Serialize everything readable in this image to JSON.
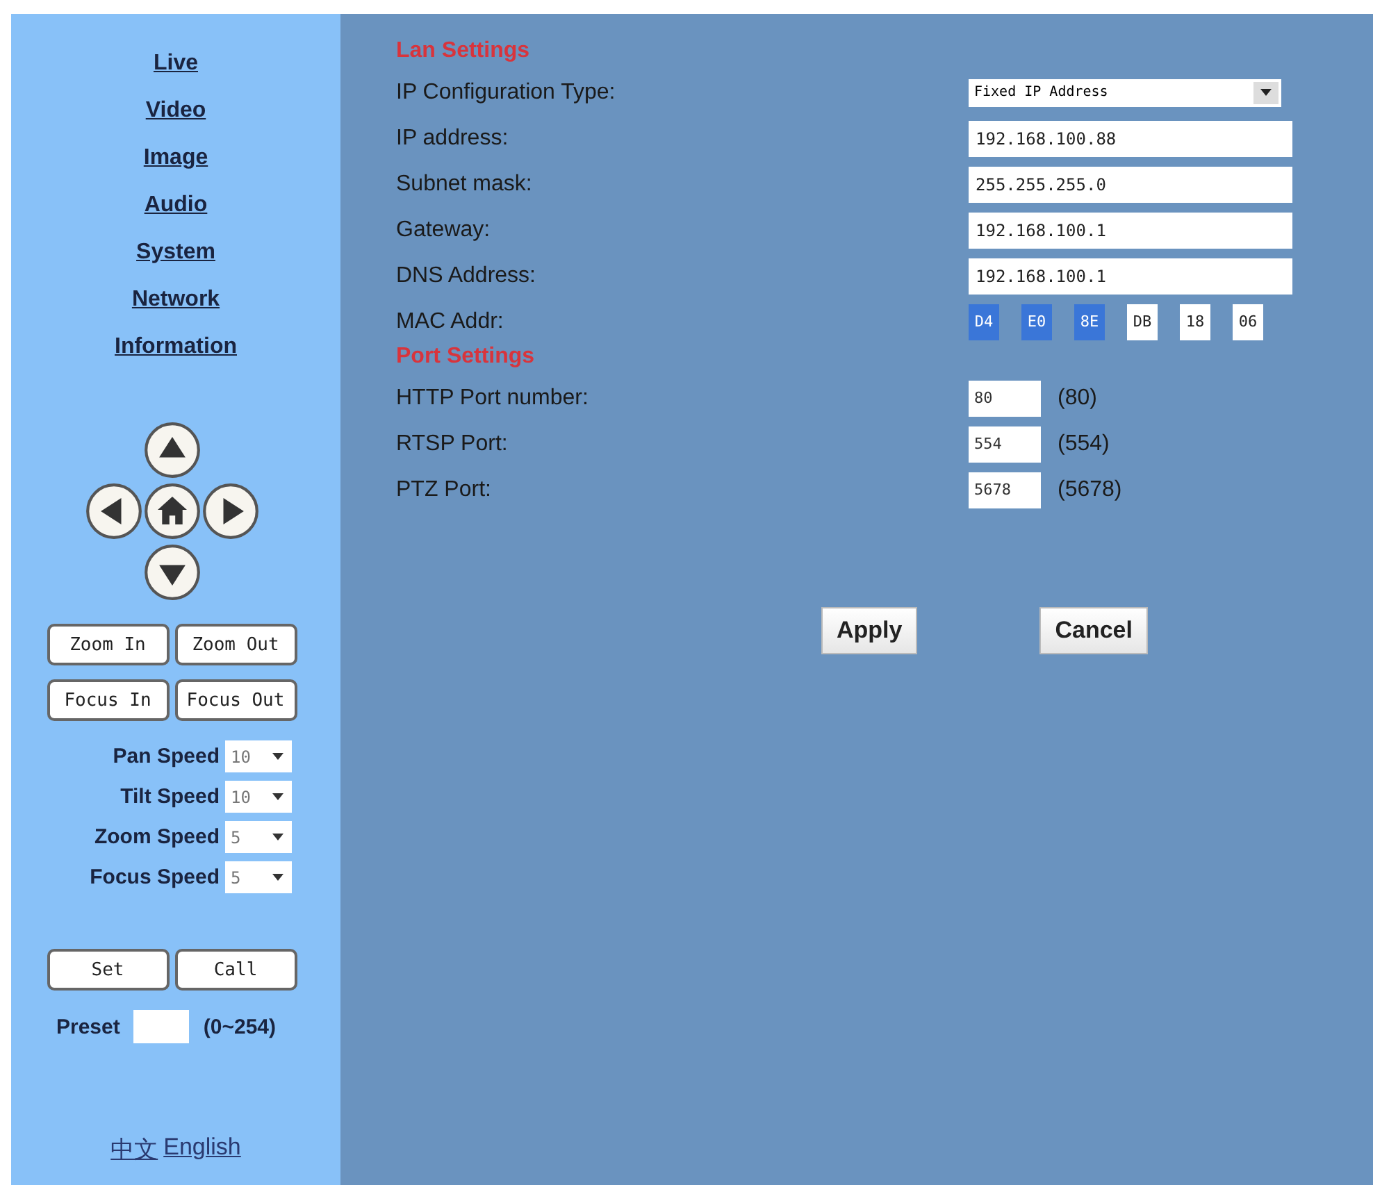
{
  "sidebar": {
    "nav": [
      {
        "label": "Live"
      },
      {
        "label": "Video"
      },
      {
        "label": "Image"
      },
      {
        "label": "Audio"
      },
      {
        "label": "System"
      },
      {
        "label": "Network"
      },
      {
        "label": "Information"
      }
    ],
    "lens_buttons": [
      "Zoom In",
      "Zoom Out",
      "Focus In",
      "Focus Out"
    ],
    "speeds": [
      {
        "label": "Pan Speed",
        "value": "10"
      },
      {
        "label": "Tilt Speed",
        "value": "10"
      },
      {
        "label": "Zoom Speed",
        "value": "5"
      },
      {
        "label": "Focus Speed",
        "value": "5"
      }
    ],
    "preset_buttons": [
      "Set",
      "Call"
    ],
    "preset": {
      "label": "Preset",
      "range": "(0~254)"
    },
    "languages": [
      "中文",
      "English"
    ]
  },
  "lan": {
    "title": "Lan Settings",
    "fields": [
      {
        "label": "IP Configuration Type:",
        "kind": "select",
        "value": "Fixed IP Address"
      },
      {
        "label": "IP address:",
        "kind": "text",
        "value": "192.168.100.88"
      },
      {
        "label": "Subnet mask:",
        "kind": "text",
        "value": "255.255.255.0"
      },
      {
        "label": "Gateway:",
        "kind": "text",
        "value": "192.168.100.1"
      },
      {
        "label": "DNS Address:",
        "kind": "text",
        "value": "192.168.100.1"
      },
      {
        "label": "MAC Addr:",
        "kind": "mac",
        "parts": [
          {
            "value": "D4",
            "selected": true
          },
          {
            "value": "E0",
            "selected": true
          },
          {
            "value": "8E",
            "selected": true
          },
          {
            "value": "DB",
            "selected": false
          },
          {
            "value": "18",
            "selected": false
          },
          {
            "value": "06",
            "selected": false
          }
        ]
      }
    ]
  },
  "ports": {
    "title": "Port Settings",
    "fields": [
      {
        "label": "HTTP Port number:",
        "value": "80",
        "default": "(80)"
      },
      {
        "label": "RTSP Port:",
        "value": "554",
        "default": "(554)"
      },
      {
        "label": "PTZ Port:",
        "value": "5678",
        "default": "(5678)"
      }
    ]
  },
  "buttons": [
    "Apply",
    "Cancel"
  ]
}
